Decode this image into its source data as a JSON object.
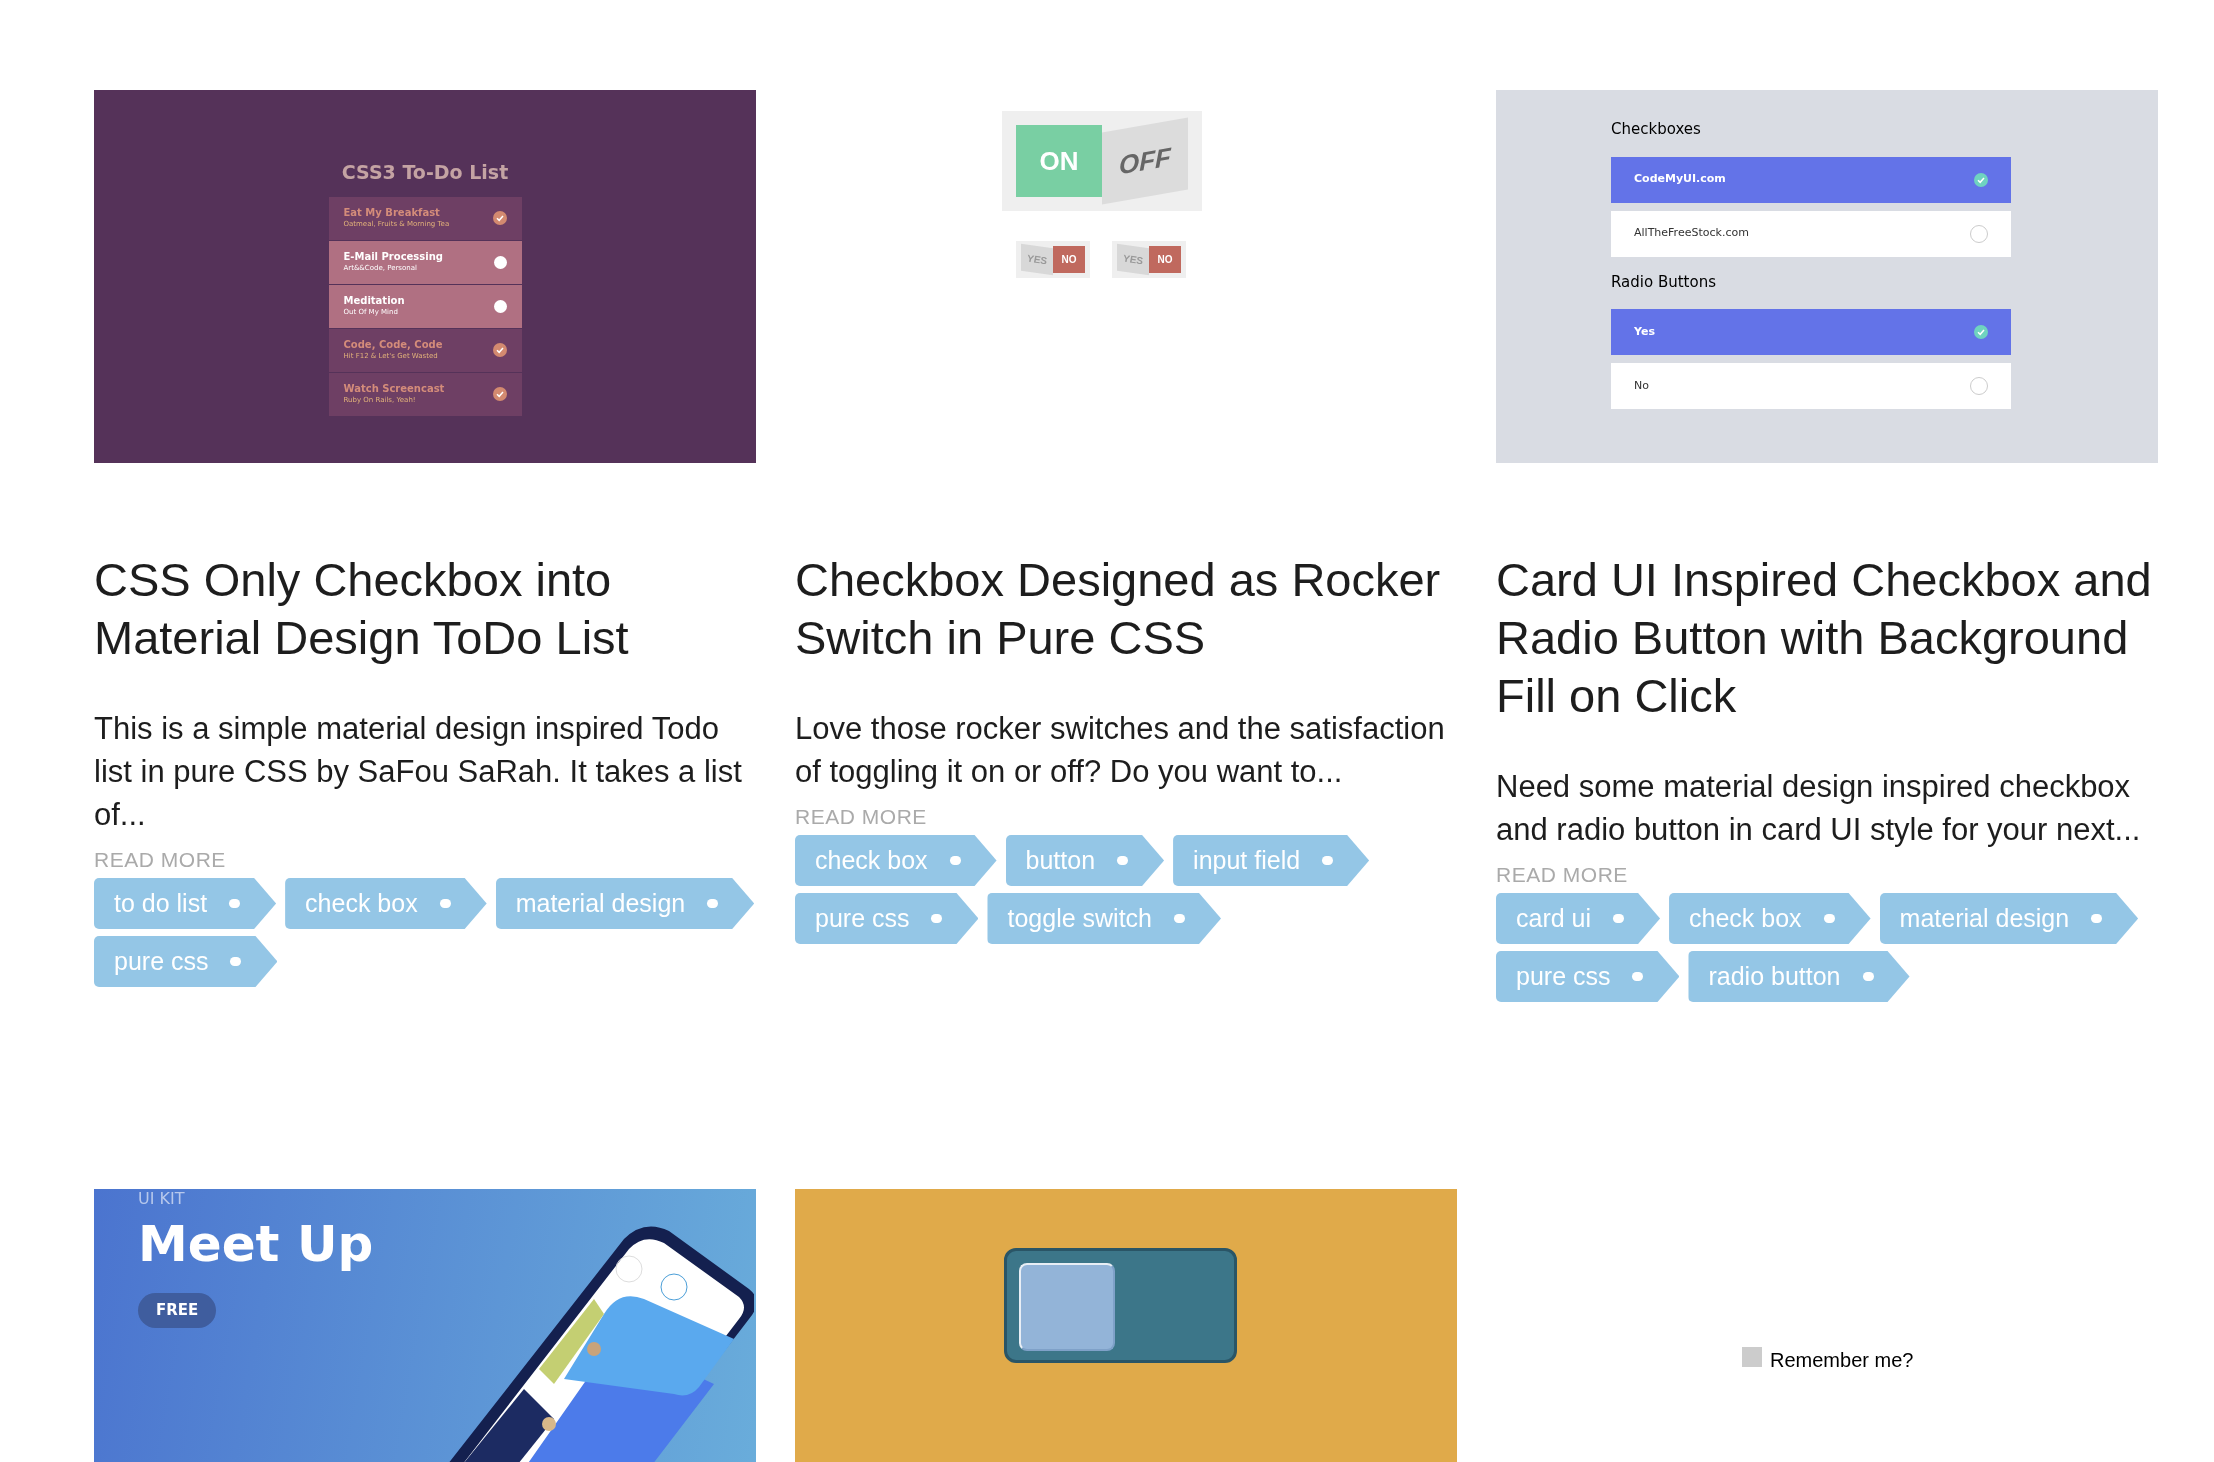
{
  "cards": [
    {
      "thumbnail": {
        "kind": "todo",
        "title": "CSS3 To-Do List",
        "items": [
          {
            "title": "Eat My Breakfast",
            "subtitle": "Oatmeal, Fruits & Morning Tea",
            "done": true
          },
          {
            "title": "E-Mail Processing",
            "subtitle": "Art&&Code, Personal",
            "done": false
          },
          {
            "title": "Meditation",
            "subtitle": "Out Of My Mind",
            "done": false
          },
          {
            "title": "Code, Code, Code",
            "subtitle": "Hit F12 & Let's Get Wasted",
            "done": true
          },
          {
            "title": "Watch Screencast",
            "subtitle": "Ruby On Rails, Yeah!",
            "done": true
          }
        ]
      },
      "title": "CSS Only Checkbox into Material Design ToDo List",
      "description": "This is a simple material design inspired Todo list in pure CSS by SaFou SaRah. It takes a list of...",
      "read_more": "READ MORE",
      "tags": [
        "to do list",
        "check box",
        "material design",
        "pure css"
      ]
    },
    {
      "thumbnail": {
        "kind": "rocker",
        "switches": [
          {
            "kind": "large",
            "on_label": "ON",
            "off_label": "OFF",
            "on": true
          },
          {
            "kind": "small",
            "on_label": "YES",
            "off_label": "NO",
            "on": false
          },
          {
            "kind": "small",
            "on_label": "YES",
            "off_label": "NO",
            "on": false
          }
        ]
      },
      "title": "Checkbox Designed as Rocker Switch in Pure CSS",
      "description": "Love those rocker switches and the satisfaction of toggling it on or off? Do you want to...",
      "read_more": "READ MORE",
      "tags": [
        "check box",
        "button",
        "input field",
        "pure css",
        "toggle switch"
      ]
    },
    {
      "thumbnail": {
        "kind": "cards",
        "sections": [
          {
            "heading": "Checkboxes",
            "options": [
              {
                "label": "CodeMyUI.com",
                "checked": true
              },
              {
                "label": "AllTheFreeStock.com",
                "checked": false
              }
            ]
          },
          {
            "heading": "Radio Buttons",
            "options": [
              {
                "label": "Yes",
                "checked": true
              },
              {
                "label": "No",
                "checked": false
              }
            ]
          }
        ]
      },
      "title": "Card UI Inspired Checkbox and Radio Button with Background Fill on Click",
      "description": "Need some material design inspired checkbox and radio button in card UI style for your next...",
      "read_more": "READ MORE",
      "tags": [
        "card ui",
        "check box",
        "material design",
        "pure css",
        "radio button"
      ]
    },
    {
      "thumbnail": {
        "kind": "promo",
        "kicker": "UI KIT",
        "title": "Meet Up",
        "badge": "FREE"
      }
    },
    {
      "thumbnail": {
        "kind": "toggle",
        "on": false
      }
    },
    {
      "thumbnail": {
        "kind": "remember",
        "label": "Remember me?",
        "checked": false
      }
    }
  ]
}
